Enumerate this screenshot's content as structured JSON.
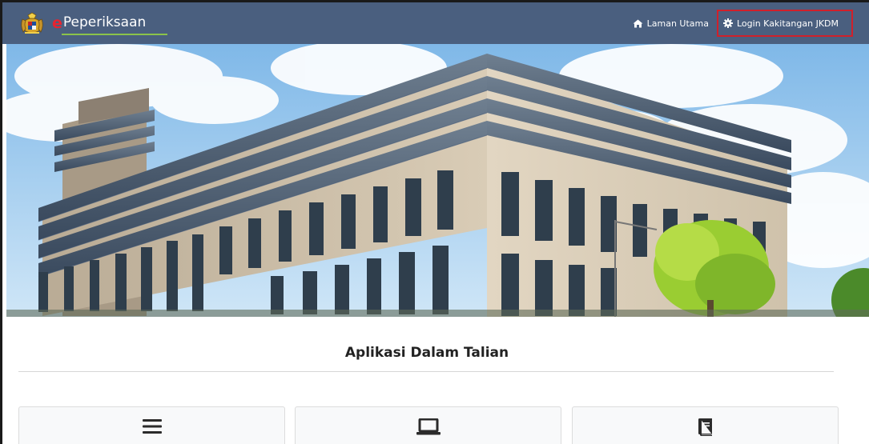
{
  "navbar": {
    "brand_prefix": "e",
    "brand_name": "Peperiksaan",
    "links": [
      {
        "label": "Laman Utama",
        "icon": "home-icon"
      },
      {
        "label": "Login Kakitangan JKDM",
        "icon": "gear-icon",
        "highlighted": true
      }
    ]
  },
  "section": {
    "title": "Aplikasi Dalam Talian"
  },
  "cards": [
    {
      "icon": "menu-icon"
    },
    {
      "icon": "laptop-icon"
    },
    {
      "icon": "book-icon"
    }
  ],
  "colors": {
    "navbar_bg": "#4a5f7f",
    "brand_accent": "#e8232f",
    "brand_underline": "#8bc34a",
    "highlight_border": "#d0202b"
  }
}
